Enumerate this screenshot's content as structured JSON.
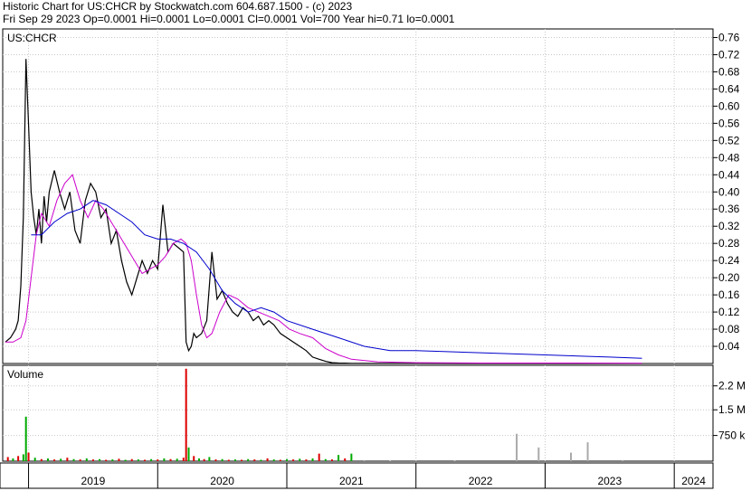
{
  "header": {
    "line1": "Historic Chart for US:CHCR by Stockwatch.com 604.687.1500 - (c) 2023",
    "line2": "Fri Sep 29 2023   Op=0.0001   Hi=0.0001   Lo=0.0001   Cl=0.0001   Vol=700   Year hi=0.71   lo=0.0001"
  },
  "colors": {
    "price": "#000000",
    "ma_short": "#cc00cc",
    "ma_long": "#0000cc",
    "down": "#cc0000",
    "vol_up": "#00aa00",
    "vol_down": "#dd0000",
    "vol_grey": "#aaaaaa",
    "grid": "#c8c8c8"
  },
  "chart_data": [
    {
      "type": "line",
      "title": "US:CHCR",
      "ylim": [
        0,
        0.78
      ],
      "yticks": [
        0.04,
        0.08,
        0.12,
        0.16,
        0.2,
        0.24,
        0.28,
        0.32,
        0.36,
        0.4,
        0.44,
        0.48,
        0.52,
        0.56,
        0.6,
        0.64,
        0.68,
        0.72,
        0.76
      ],
      "ytick_labels": [
        "0.04",
        "0.08",
        "0.12",
        "0.16",
        "0.20",
        "0.24",
        "0.28",
        "0.32",
        "0.36",
        "0.40",
        "0.44",
        "0.48",
        "0.52",
        "0.56",
        "0.60",
        "0.64",
        "0.68",
        "0.72",
        "0.76"
      ],
      "x_range": [
        2018.8,
        2024.3
      ],
      "x_grid": [
        2019,
        2020,
        2021,
        2022,
        2023,
        2024
      ],
      "series": [
        {
          "x": [
            2018.82,
            2018.86,
            2018.9,
            2018.92,
            2018.94,
            2018.96,
            2018.98,
            2019.0,
            2019.02,
            2019.04,
            2019.06,
            2019.08,
            2019.1,
            2019.12,
            2019.14,
            2019.16,
            2019.2,
            2019.24,
            2019.28,
            2019.32,
            2019.36,
            2019.4,
            2019.44,
            2019.48,
            2019.52,
            2019.56,
            2019.6,
            2019.64,
            2019.68,
            2019.72,
            2019.76,
            2019.8,
            2019.84,
            2019.88,
            2019.92,
            2019.96,
            2020.0,
            2020.04,
            2020.08,
            2020.12,
            2020.16,
            2020.2,
            2020.22,
            2020.24,
            2020.26,
            2020.28,
            2020.3,
            2020.34,
            2020.38,
            2020.42,
            2020.46,
            2020.5,
            2020.54,
            2020.58,
            2020.62,
            2020.66,
            2020.7,
            2020.74,
            2020.78,
            2020.82,
            2020.86,
            2020.9,
            2020.95,
            2021.0,
            2021.05,
            2021.1,
            2021.15,
            2021.2,
            2021.25,
            2021.3,
            2021.35,
            2021.4,
            2021.45,
            2021.5,
            2021.6,
            2021.8,
            2022.0,
            2022.5,
            2023.0,
            2023.5,
            2023.75
          ],
          "values": [
            0.05,
            0.06,
            0.08,
            0.1,
            0.18,
            0.34,
            0.71,
            0.56,
            0.4,
            0.34,
            0.3,
            0.36,
            0.28,
            0.39,
            0.33,
            0.4,
            0.45,
            0.4,
            0.36,
            0.4,
            0.31,
            0.28,
            0.38,
            0.42,
            0.4,
            0.34,
            0.36,
            0.28,
            0.31,
            0.24,
            0.19,
            0.16,
            0.2,
            0.24,
            0.21,
            0.24,
            0.22,
            0.37,
            0.26,
            0.28,
            0.27,
            0.26,
            0.05,
            0.03,
            0.04,
            0.07,
            0.06,
            0.07,
            0.1,
            0.26,
            0.15,
            0.17,
            0.14,
            0.12,
            0.11,
            0.13,
            0.12,
            0.1,
            0.11,
            0.09,
            0.1,
            0.09,
            0.07,
            0.06,
            0.05,
            0.04,
            0.03,
            0.015,
            0.01,
            0.005,
            0.002,
            0.001,
            0.0008,
            0.0005,
            0.0004,
            0.0003,
            0.0002,
            0.0001,
            0.0001,
            0.0001,
            0.0001
          ]
        },
        {
          "x": [
            2018.82,
            2018.88,
            2018.94,
            2018.98,
            2019.02,
            2019.06,
            2019.1,
            2019.16,
            2019.22,
            2019.28,
            2019.34,
            2019.4,
            2019.46,
            2019.52,
            2019.58,
            2019.64,
            2019.7,
            2019.76,
            2019.82,
            2019.88,
            2019.94,
            2020.0,
            2020.06,
            2020.12,
            2020.18,
            2020.22,
            2020.26,
            2020.3,
            2020.34,
            2020.38,
            2020.42,
            2020.48,
            2020.55,
            2020.62,
            2020.7,
            2020.78,
            2020.86,
            2020.94,
            2021.02,
            2021.1,
            2021.2,
            2021.3,
            2021.4,
            2021.5,
            2021.7,
            2022.0,
            2022.5,
            2023.0,
            2023.5,
            2023.75
          ],
          "values": [
            0.05,
            0.05,
            0.06,
            0.1,
            0.2,
            0.3,
            0.35,
            0.32,
            0.38,
            0.42,
            0.44,
            0.38,
            0.34,
            0.38,
            0.36,
            0.33,
            0.3,
            0.27,
            0.24,
            0.21,
            0.22,
            0.23,
            0.25,
            0.28,
            0.29,
            0.28,
            0.24,
            0.16,
            0.09,
            0.06,
            0.07,
            0.12,
            0.16,
            0.15,
            0.13,
            0.12,
            0.11,
            0.1,
            0.08,
            0.07,
            0.06,
            0.035,
            0.02,
            0.01,
            0.004,
            0.002,
            0.001,
            0.001,
            0.0008,
            0.0005
          ]
        },
        {
          "x": [
            2019.02,
            2019.1,
            2019.2,
            2019.3,
            2019.4,
            2019.5,
            2019.6,
            2019.7,
            2019.8,
            2019.9,
            2020.0,
            2020.1,
            2020.2,
            2020.3,
            2020.4,
            2020.5,
            2020.6,
            2020.7,
            2020.8,
            2020.9,
            2021.0,
            2021.2,
            2021.4,
            2021.6,
            2021.8,
            2022.0,
            2022.5,
            2023.0,
            2023.5,
            2023.75
          ],
          "values": [
            0.3,
            0.3,
            0.33,
            0.35,
            0.36,
            0.38,
            0.37,
            0.35,
            0.33,
            0.3,
            0.29,
            0.29,
            0.28,
            0.26,
            0.22,
            0.17,
            0.14,
            0.12,
            0.13,
            0.12,
            0.1,
            0.08,
            0.06,
            0.04,
            0.03,
            0.03,
            0.025,
            0.02,
            0.015,
            0.012
          ]
        }
      ]
    },
    {
      "type": "bar",
      "title": "Volume",
      "ylim": [
        0,
        2.8
      ],
      "yticks": [
        0.75,
        1.5,
        2.2
      ],
      "ytick_labels": [
        "750 k",
        "1.5 M",
        "2.2 M"
      ],
      "x_range": [
        2018.8,
        2024.3
      ],
      "categories": [
        "2019",
        "2020",
        "2021",
        "2022",
        "2023",
        "2024"
      ],
      "bars": [
        {
          "x": 2018.84,
          "v": 0.12,
          "c": "down"
        },
        {
          "x": 2018.88,
          "v": 0.08,
          "c": "up"
        },
        {
          "x": 2018.92,
          "v": 0.15,
          "c": "down"
        },
        {
          "x": 2018.96,
          "v": 0.2,
          "c": "up"
        },
        {
          "x": 2018.98,
          "v": 1.3,
          "c": "up"
        },
        {
          "x": 2019.0,
          "v": 0.25,
          "c": "down"
        },
        {
          "x": 2019.05,
          "v": 0.1,
          "c": "up"
        },
        {
          "x": 2019.1,
          "v": 0.06,
          "c": "down"
        },
        {
          "x": 2019.15,
          "v": 0.08,
          "c": "up"
        },
        {
          "x": 2019.2,
          "v": 0.05,
          "c": "down"
        },
        {
          "x": 2019.25,
          "v": 0.07,
          "c": "up"
        },
        {
          "x": 2019.3,
          "v": 0.1,
          "c": "down"
        },
        {
          "x": 2019.35,
          "v": 0.06,
          "c": "up"
        },
        {
          "x": 2019.4,
          "v": 0.05,
          "c": "down"
        },
        {
          "x": 2019.45,
          "v": 0.08,
          "c": "up"
        },
        {
          "x": 2019.5,
          "v": 0.05,
          "c": "down"
        },
        {
          "x": 2019.55,
          "v": 0.06,
          "c": "up"
        },
        {
          "x": 2019.6,
          "v": 0.04,
          "c": "down"
        },
        {
          "x": 2019.65,
          "v": 0.05,
          "c": "up"
        },
        {
          "x": 2019.7,
          "v": 0.07,
          "c": "down"
        },
        {
          "x": 2019.75,
          "v": 0.04,
          "c": "up"
        },
        {
          "x": 2019.8,
          "v": 0.06,
          "c": "down"
        },
        {
          "x": 2019.85,
          "v": 0.05,
          "c": "up"
        },
        {
          "x": 2019.9,
          "v": 0.04,
          "c": "down"
        },
        {
          "x": 2019.95,
          "v": 0.06,
          "c": "up"
        },
        {
          "x": 2020.0,
          "v": 0.05,
          "c": "down"
        },
        {
          "x": 2020.05,
          "v": 0.08,
          "c": "up"
        },
        {
          "x": 2020.1,
          "v": 0.06,
          "c": "down"
        },
        {
          "x": 2020.15,
          "v": 0.07,
          "c": "up"
        },
        {
          "x": 2020.2,
          "v": 0.1,
          "c": "down"
        },
        {
          "x": 2020.22,
          "v": 2.7,
          "c": "down"
        },
        {
          "x": 2020.24,
          "v": 0.4,
          "c": "up"
        },
        {
          "x": 2020.28,
          "v": 0.15,
          "c": "down"
        },
        {
          "x": 2020.32,
          "v": 0.08,
          "c": "up"
        },
        {
          "x": 2020.36,
          "v": 0.06,
          "c": "down"
        },
        {
          "x": 2020.4,
          "v": 0.12,
          "c": "up"
        },
        {
          "x": 2020.45,
          "v": 0.05,
          "c": "down"
        },
        {
          "x": 2020.5,
          "v": 0.06,
          "c": "up"
        },
        {
          "x": 2020.55,
          "v": 0.04,
          "c": "down"
        },
        {
          "x": 2020.6,
          "v": 0.05,
          "c": "up"
        },
        {
          "x": 2020.65,
          "v": 0.04,
          "c": "down"
        },
        {
          "x": 2020.7,
          "v": 0.06,
          "c": "up"
        },
        {
          "x": 2020.75,
          "v": 0.05,
          "c": "down"
        },
        {
          "x": 2020.8,
          "v": 0.04,
          "c": "up"
        },
        {
          "x": 2020.85,
          "v": 0.08,
          "c": "down"
        },
        {
          "x": 2020.9,
          "v": 0.05,
          "c": "up"
        },
        {
          "x": 2020.95,
          "v": 0.04,
          "c": "down"
        },
        {
          "x": 2021.0,
          "v": 0.06,
          "c": "up"
        },
        {
          "x": 2021.05,
          "v": 0.05,
          "c": "down"
        },
        {
          "x": 2021.1,
          "v": 0.07,
          "c": "up"
        },
        {
          "x": 2021.15,
          "v": 0.05,
          "c": "down"
        },
        {
          "x": 2021.2,
          "v": 0.08,
          "c": "up"
        },
        {
          "x": 2021.25,
          "v": 0.22,
          "c": "down"
        },
        {
          "x": 2021.3,
          "v": 0.06,
          "c": "up"
        },
        {
          "x": 2021.35,
          "v": 0.05,
          "c": "down"
        },
        {
          "x": 2021.4,
          "v": 0.18,
          "c": "up"
        },
        {
          "x": 2021.45,
          "v": 0.08,
          "c": "down"
        },
        {
          "x": 2021.5,
          "v": 0.22,
          "c": "up"
        },
        {
          "x": 2021.6,
          "v": 0.03,
          "c": "grey"
        },
        {
          "x": 2021.8,
          "v": 0.02,
          "c": "grey"
        },
        {
          "x": 2022.0,
          "v": 0.03,
          "c": "grey"
        },
        {
          "x": 2022.3,
          "v": 0.02,
          "c": "grey"
        },
        {
          "x": 2022.78,
          "v": 0.8,
          "c": "grey"
        },
        {
          "x": 2022.95,
          "v": 0.4,
          "c": "grey"
        },
        {
          "x": 2023.2,
          "v": 0.25,
          "c": "grey"
        },
        {
          "x": 2023.33,
          "v": 0.55,
          "c": "grey"
        },
        {
          "x": 2023.6,
          "v": 0.03,
          "c": "grey"
        }
      ]
    }
  ]
}
